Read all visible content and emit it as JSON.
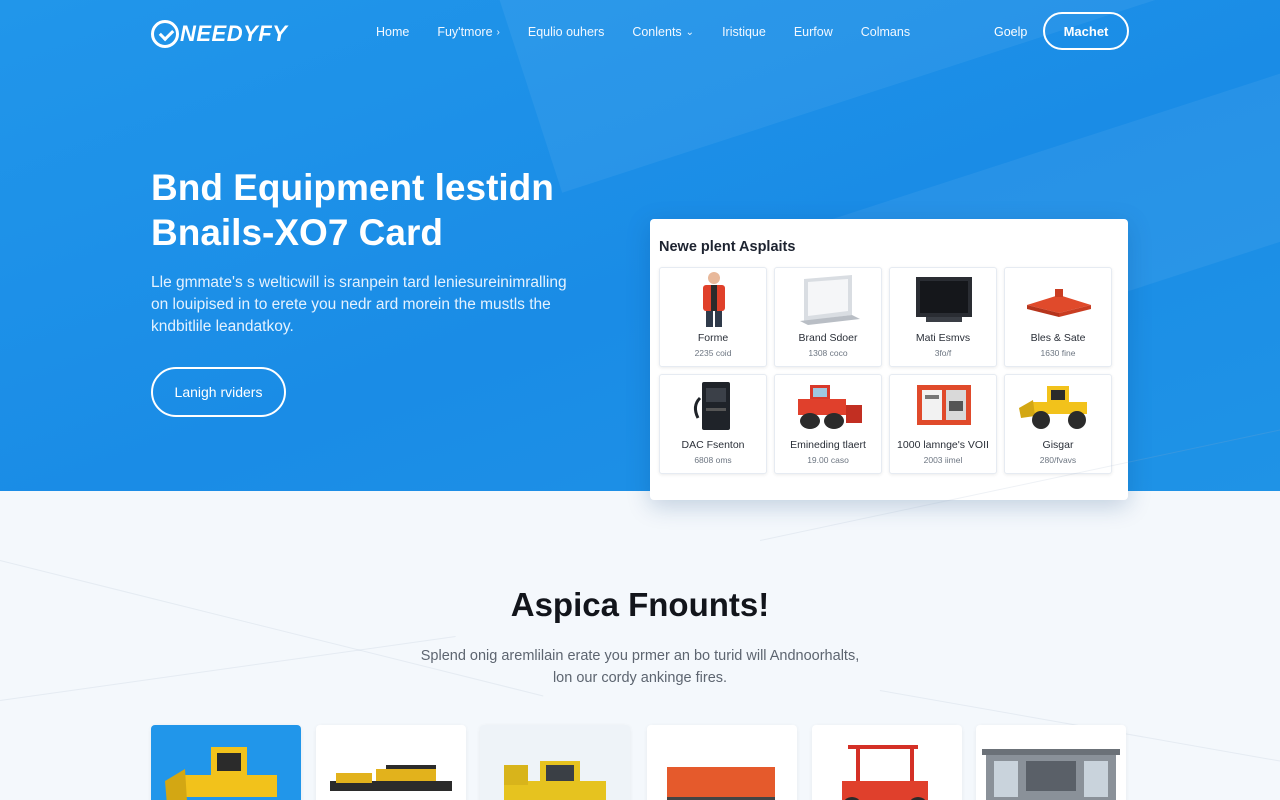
{
  "brand": {
    "name": "NEEDYFY"
  },
  "nav": {
    "items": [
      {
        "label": "Home",
        "chevron": false
      },
      {
        "label": "Fuy'tmore",
        "chevron": true
      },
      {
        "label": "Equlio ouhers",
        "chevron": false
      },
      {
        "label": "Conlents",
        "chevron": true
      },
      {
        "label": "Iristique",
        "chevron": false
      },
      {
        "label": "Eurfow",
        "chevron": false
      },
      {
        "label": "Colmans",
        "chevron": false
      }
    ],
    "help_label": "Goelp",
    "cta_label": "Machet"
  },
  "hero": {
    "title_line1": "Bnd Equipment lestidn",
    "title_line2": "Bnails-XO7 Card",
    "subtitle_line1": "Lle gmmate's s welticwill is sranpein tard leniesureinimralling",
    "subtitle_line2": "on louipised in to erete you nedr ard morein the mustls the",
    "subtitle_line3": "kndbitlile leandatkoy.",
    "button_label": "Lanigh rviders"
  },
  "listing_card": {
    "title": "Newe plent Asplaits",
    "items": [
      {
        "name": "Forme",
        "price": "2235 coid",
        "icon": "worker-vest-icon"
      },
      {
        "name": "Brand Sdoer",
        "price": "1308 coco",
        "icon": "laptop-icon"
      },
      {
        "name": "Mati Esmvs",
        "price": "3fo/f",
        "icon": "monitor-icon"
      },
      {
        "name": "Bles & Sate",
        "price": "1630 fine",
        "icon": "red-platform-icon"
      },
      {
        "name": "DAC Fsenton",
        "price": "6808 oms",
        "icon": "generator-icon"
      },
      {
        "name": "Emineding tlaert",
        "price": "19.00 caso",
        "icon": "red-bulldozer-icon"
      },
      {
        "name": "1000 lamnge's VOII",
        "price": "2003 iimel",
        "icon": "red-cabinet-icon"
      },
      {
        "name": "Gisgar",
        "price": "280/fvavs",
        "icon": "yellow-loader-icon"
      }
    ]
  },
  "section": {
    "title": "Aspica Fnounts!",
    "subtitle_line1": "Splend onig aremlilain erate you prmer an bo turid will Andnoorhalts,",
    "subtitle_line2": "lon our cordy ankinge fires."
  },
  "bottom_cards": [
    {
      "icon": "yellow-loader-icon",
      "active": true
    },
    {
      "icon": "tractor-trailer-icon",
      "active": false
    },
    {
      "icon": "yellow-bulldozer-icon",
      "active": false
    },
    {
      "icon": "orange-container-icon",
      "active": false
    },
    {
      "icon": "red-tractor-icon",
      "active": false
    },
    {
      "icon": "grey-cabin-icon",
      "active": false
    }
  ],
  "colors": {
    "hero_blue": "#1e91e8",
    "accent_red": "#e04a2b",
    "accent_yellow": "#f2c21b"
  }
}
